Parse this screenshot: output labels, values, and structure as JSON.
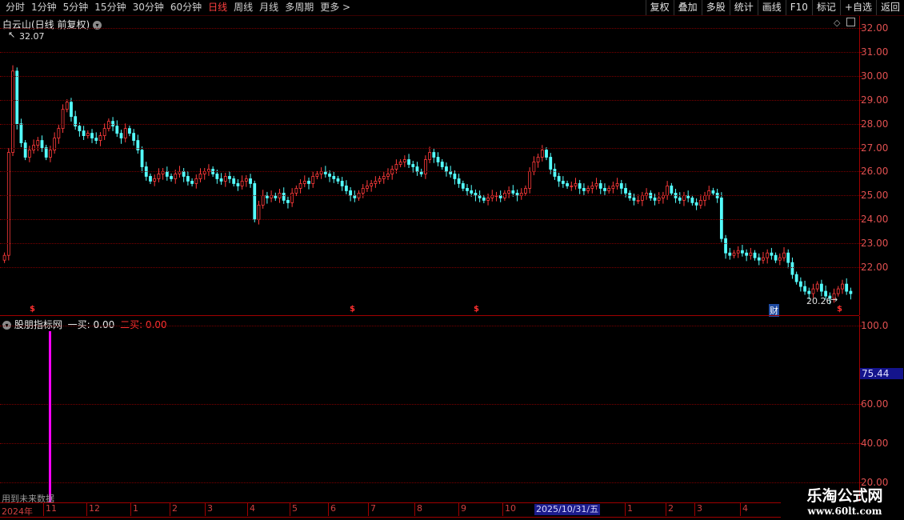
{
  "toolbar": {
    "tabs": [
      "分时",
      "1分钟",
      "5分钟",
      "15分钟",
      "30分钟",
      "60分钟",
      "日线",
      "周线",
      "月线",
      "多周期",
      "更多 >"
    ],
    "active_tab": "日线",
    "right_buttons": [
      "复权",
      "叠加",
      "多股",
      "统计",
      "画线",
      "F10",
      "标记",
      "+自选",
      "返回"
    ]
  },
  "price_panel": {
    "title": "白云山(日线 前复权)",
    "high_label": "32.07",
    "low_label": "20.26",
    "y_ticks": [
      "32.00",
      "31.00",
      "30.00",
      "29.00",
      "28.00",
      "27.00",
      "26.00",
      "25.00",
      "24.00",
      "23.00",
      "22.00"
    ],
    "markers": [
      "$",
      "$",
      "$",
      "财",
      "$"
    ]
  },
  "indicator_panel": {
    "name": "股朋指标网",
    "buy1": "一买: 0.00",
    "buy2": "二买: 0.00",
    "y_ticks": [
      "100.0",
      "75.44",
      "60.00",
      "40.00",
      "20.00"
    ],
    "note": "用到未来数据"
  },
  "date_axis": {
    "year": "2024年",
    "months": [
      "11",
      "12",
      "1",
      "2",
      "3",
      "4",
      "5",
      "6",
      "7",
      "8",
      "9",
      "10",
      "1",
      "2",
      "3",
      "4"
    ],
    "selected_date": "2025/10/31/五"
  },
  "watermark": {
    "line1": "乐淘公式网",
    "line2": "www.60lt.com"
  },
  "colors": {
    "up": "#ff3b3b",
    "down": "#54ffff",
    "background": "#000000",
    "axis": "#a00000",
    "signal_bar": "#ff00ff"
  },
  "chart_data": {
    "type": "candlestick",
    "ylim": [
      20,
      32.5
    ],
    "close_series": [
      22.5,
      26.8,
      30.2,
      28.0,
      27.2,
      26.6,
      26.9,
      27.1,
      27.3,
      27.0,
      26.6,
      26.9,
      27.4,
      27.8,
      28.6,
      28.9,
      28.3,
      27.9,
      27.7,
      27.5,
      27.6,
      27.4,
      27.3,
      27.5,
      27.8,
      28.1,
      27.9,
      27.6,
      27.4,
      27.8,
      27.6,
      27.3,
      26.9,
      26.2,
      25.8,
      25.6,
      25.7,
      25.9,
      26.0,
      25.8,
      25.7,
      25.9,
      26.0,
      25.8,
      25.6,
      25.5,
      25.7,
      25.9,
      26.0,
      26.1,
      25.9,
      25.7,
      25.6,
      25.8,
      25.7,
      25.5,
      25.4,
      25.6,
      25.7,
      25.5,
      24.0,
      24.6,
      25.0,
      24.9,
      25.0,
      24.9,
      25.1,
      24.8,
      24.7,
      25.1,
      25.3,
      25.5,
      25.6,
      25.5,
      25.8,
      25.9,
      26.0,
      25.9,
      25.8,
      25.7,
      25.6,
      25.4,
      25.2,
      25.0,
      24.9,
      25.1,
      25.3,
      25.4,
      25.5,
      25.6,
      25.7,
      25.8,
      25.9,
      26.1,
      26.3,
      26.4,
      26.5,
      26.3,
      26.2,
      26.0,
      25.9,
      26.5,
      26.8,
      26.6,
      26.4,
      26.2,
      26.0,
      25.9,
      25.7,
      25.5,
      25.3,
      25.2,
      25.1,
      25.0,
      24.9,
      24.8,
      24.9,
      25.0,
      25.0,
      24.9,
      25.1,
      25.2,
      25.1,
      25.0,
      25.1,
      25.3,
      26.0,
      26.4,
      26.6,
      26.9,
      26.6,
      26.1,
      25.8,
      25.6,
      25.5,
      25.4,
      25.4,
      25.5,
      25.3,
      25.2,
      25.3,
      25.4,
      25.5,
      25.3,
      25.2,
      25.3,
      25.4,
      25.5,
      25.3,
      25.1,
      24.9,
      24.8,
      24.8,
      25.0,
      25.1,
      24.9,
      24.8,
      24.9,
      25.0,
      25.4,
      25.1,
      24.9,
      24.8,
      25.0,
      24.9,
      24.7,
      24.6,
      24.8,
      25.0,
      25.2,
      25.1,
      24.9,
      23.2,
      22.6,
      22.5,
      22.6,
      22.7,
      22.6,
      22.5,
      22.6,
      22.4,
      22.3,
      22.4,
      22.6,
      22.5,
      22.3,
      22.4,
      22.6,
      22.2,
      21.7,
      21.4,
      21.2,
      21.0,
      20.9,
      21.1,
      21.3,
      21.0,
      20.8,
      20.7,
      20.9,
      21.1,
      21.3,
      21.0,
      20.9
    ]
  }
}
